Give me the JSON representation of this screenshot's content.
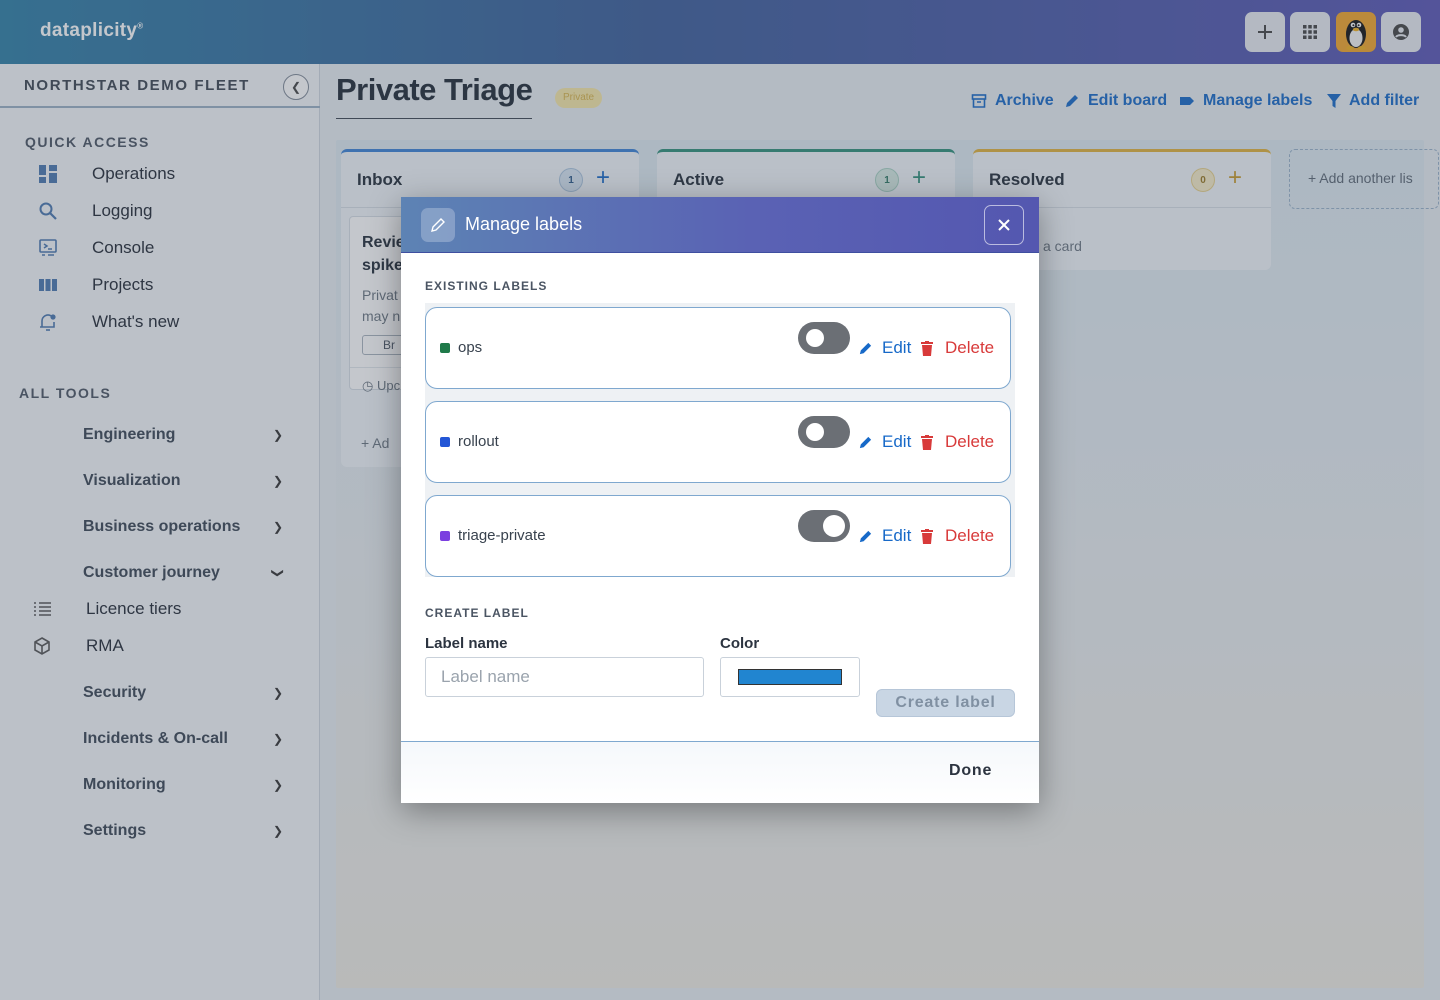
{
  "app": {
    "brand": "dataplicity",
    "brand_mark": "®"
  },
  "topbar": {
    "icons": [
      "plus-icon",
      "apps-grid-icon",
      "tux-avatar",
      "account-icon"
    ]
  },
  "sidebar": {
    "fleet_title": "NORTHSTAR DEMO FLEET",
    "quick_access_title": "QUICK ACCESS",
    "quick_access": [
      {
        "label": "Operations",
        "icon": "dashboard-icon"
      },
      {
        "label": "Logging",
        "icon": "search-icon"
      },
      {
        "label": "Console",
        "icon": "console-icon"
      },
      {
        "label": "Projects",
        "icon": "columns-icon"
      },
      {
        "label": "What's new",
        "icon": "bell-icon"
      }
    ],
    "all_tools_title": "ALL TOOLS",
    "tools": [
      {
        "label": "Engineering"
      },
      {
        "label": "Visualization"
      },
      {
        "label": "Business operations"
      },
      {
        "label": "Customer journey",
        "expanded": true
      }
    ],
    "sub_tools": [
      {
        "label": "Licence tiers",
        "icon": "list-icon"
      },
      {
        "label": "RMA",
        "icon": "package-icon"
      }
    ],
    "tools_after": [
      {
        "label": "Security"
      },
      {
        "label": "Incidents & On-call"
      },
      {
        "label": "Monitoring"
      },
      {
        "label": "Settings"
      }
    ]
  },
  "page": {
    "title": "Private Triage",
    "badge": "Private",
    "actions": [
      {
        "label": "Archive",
        "icon": "archive-icon"
      },
      {
        "label": "Edit board",
        "icon": "pencil-icon"
      },
      {
        "label": "Manage labels",
        "icon": "tag-icon"
      },
      {
        "label": "Add filter",
        "icon": "filter-icon"
      }
    ]
  },
  "board": {
    "lists": [
      {
        "name": "Inbox",
        "count": "1",
        "accent": "#3b82d6"
      },
      {
        "name": "Active",
        "count": "1",
        "accent": "#2f8f7a"
      },
      {
        "name": "Resolved",
        "count": "0",
        "accent": "#e0b23c"
      }
    ],
    "inbox_card": {
      "title_line1": "Revie",
      "title_line2": "spike",
      "desc_line1": "Privat",
      "desc_line2": "may n",
      "tag": "Br",
      "footer": "Upc"
    },
    "inbox_add": "Ad",
    "resolved_add": "a card",
    "add_list": "Add another lis"
  },
  "modal": {
    "title": "Manage labels",
    "existing_title": "EXISTING LABELS",
    "labels": [
      {
        "name": "ops",
        "color": "#1f7a4a",
        "enabled": false
      },
      {
        "name": "rollout",
        "color": "#2356d6",
        "enabled": false
      },
      {
        "name": "triage-private",
        "color": "#7b3fe0",
        "enabled": true
      }
    ],
    "edit_label": "Edit",
    "delete_label": "Delete",
    "create_title": "CREATE LABEL",
    "label_name_caption": "Label name",
    "label_name_placeholder": "Label name",
    "label_name_value": "",
    "color_caption": "Color",
    "color_value": "#2185d0",
    "create_button": "Create label",
    "done_button": "Done"
  }
}
